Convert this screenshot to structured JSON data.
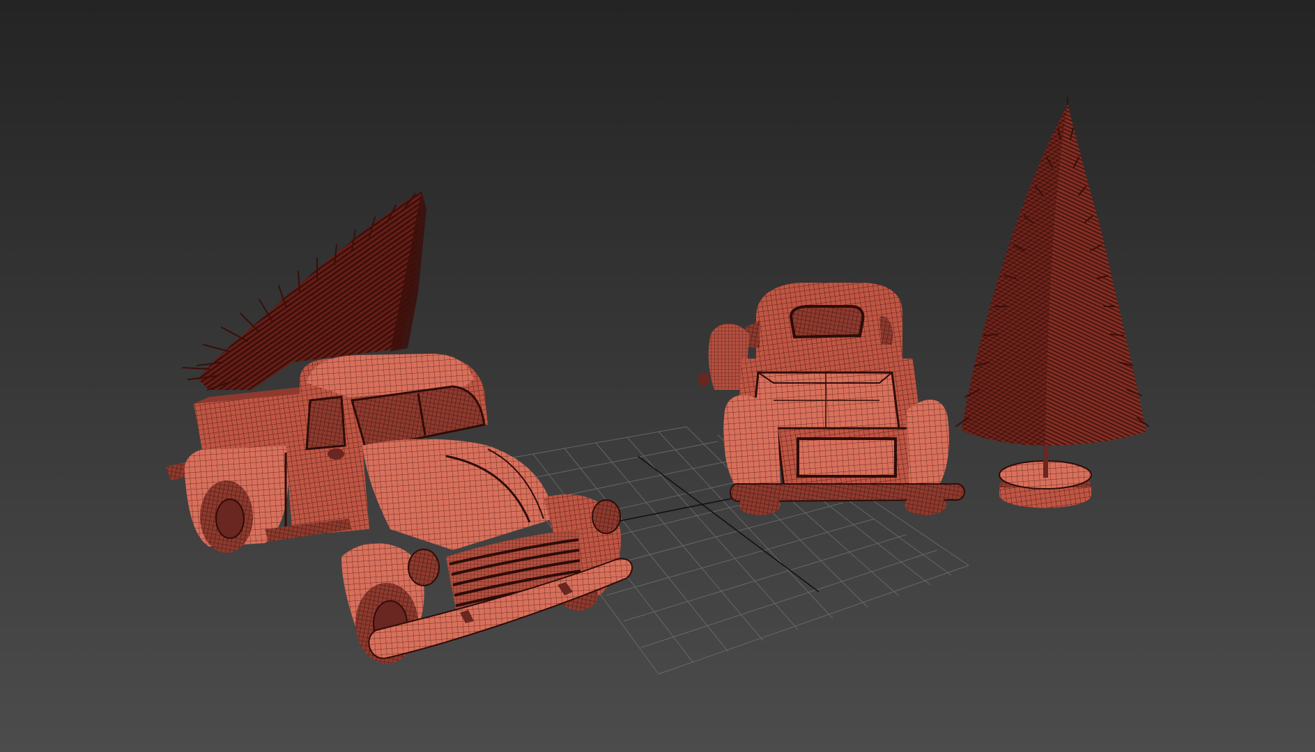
{
  "viewport": {
    "background_top": "#242424",
    "background_bottom": "#4c4c4c",
    "grid_color": "#777777",
    "axis_color": "#111111"
  },
  "colors": {
    "model_base": "#c45a48",
    "model_mid": "#a8473a",
    "model_shadow": "#6a2620",
    "model_highlight": "#e07a66",
    "wire": "#3a120e",
    "tree": "#5a1812",
    "tree_dark": "#3a0e0a"
  },
  "objects": [
    {
      "name": "pickup-truck-with-tree",
      "view": "front-three-quarter"
    },
    {
      "name": "pickup-truck",
      "view": "rear"
    },
    {
      "name": "bottle-brush-tree",
      "view": "side"
    }
  ]
}
